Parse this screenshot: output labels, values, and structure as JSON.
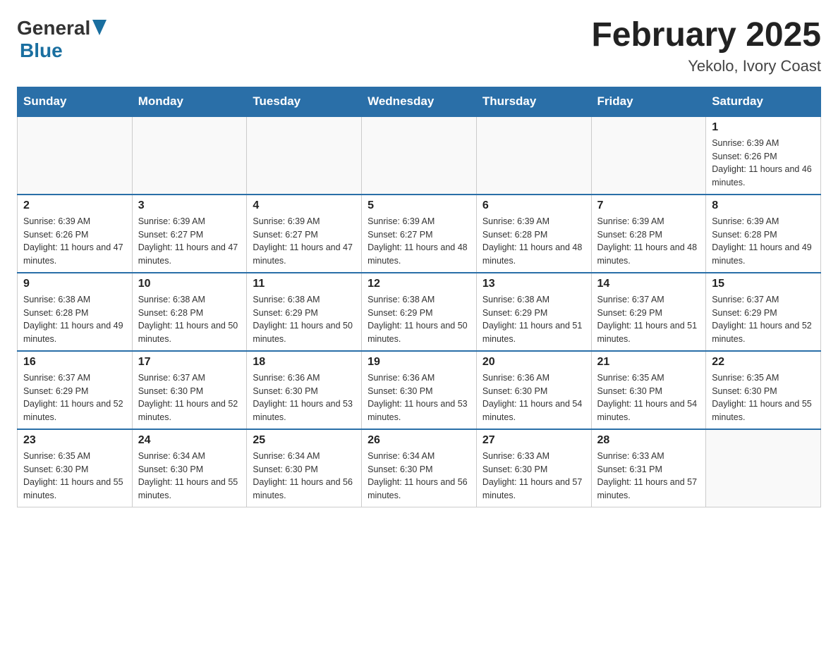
{
  "header": {
    "logo_general": "General",
    "logo_blue": "Blue",
    "month_title": "February 2025",
    "location": "Yekolo, Ivory Coast"
  },
  "days_of_week": [
    "Sunday",
    "Monday",
    "Tuesday",
    "Wednesday",
    "Thursday",
    "Friday",
    "Saturday"
  ],
  "weeks": [
    {
      "days": [
        {
          "date": "",
          "info": ""
        },
        {
          "date": "",
          "info": ""
        },
        {
          "date": "",
          "info": ""
        },
        {
          "date": "",
          "info": ""
        },
        {
          "date": "",
          "info": ""
        },
        {
          "date": "",
          "info": ""
        },
        {
          "date": "1",
          "info": "Sunrise: 6:39 AM\nSunset: 6:26 PM\nDaylight: 11 hours and 46 minutes."
        }
      ]
    },
    {
      "days": [
        {
          "date": "2",
          "info": "Sunrise: 6:39 AM\nSunset: 6:26 PM\nDaylight: 11 hours and 47 minutes."
        },
        {
          "date": "3",
          "info": "Sunrise: 6:39 AM\nSunset: 6:27 PM\nDaylight: 11 hours and 47 minutes."
        },
        {
          "date": "4",
          "info": "Sunrise: 6:39 AM\nSunset: 6:27 PM\nDaylight: 11 hours and 47 minutes."
        },
        {
          "date": "5",
          "info": "Sunrise: 6:39 AM\nSunset: 6:27 PM\nDaylight: 11 hours and 48 minutes."
        },
        {
          "date": "6",
          "info": "Sunrise: 6:39 AM\nSunset: 6:28 PM\nDaylight: 11 hours and 48 minutes."
        },
        {
          "date": "7",
          "info": "Sunrise: 6:39 AM\nSunset: 6:28 PM\nDaylight: 11 hours and 48 minutes."
        },
        {
          "date": "8",
          "info": "Sunrise: 6:39 AM\nSunset: 6:28 PM\nDaylight: 11 hours and 49 minutes."
        }
      ]
    },
    {
      "days": [
        {
          "date": "9",
          "info": "Sunrise: 6:38 AM\nSunset: 6:28 PM\nDaylight: 11 hours and 49 minutes."
        },
        {
          "date": "10",
          "info": "Sunrise: 6:38 AM\nSunset: 6:28 PM\nDaylight: 11 hours and 50 minutes."
        },
        {
          "date": "11",
          "info": "Sunrise: 6:38 AM\nSunset: 6:29 PM\nDaylight: 11 hours and 50 minutes."
        },
        {
          "date": "12",
          "info": "Sunrise: 6:38 AM\nSunset: 6:29 PM\nDaylight: 11 hours and 50 minutes."
        },
        {
          "date": "13",
          "info": "Sunrise: 6:38 AM\nSunset: 6:29 PM\nDaylight: 11 hours and 51 minutes."
        },
        {
          "date": "14",
          "info": "Sunrise: 6:37 AM\nSunset: 6:29 PM\nDaylight: 11 hours and 51 minutes."
        },
        {
          "date": "15",
          "info": "Sunrise: 6:37 AM\nSunset: 6:29 PM\nDaylight: 11 hours and 52 minutes."
        }
      ]
    },
    {
      "days": [
        {
          "date": "16",
          "info": "Sunrise: 6:37 AM\nSunset: 6:29 PM\nDaylight: 11 hours and 52 minutes."
        },
        {
          "date": "17",
          "info": "Sunrise: 6:37 AM\nSunset: 6:30 PM\nDaylight: 11 hours and 52 minutes."
        },
        {
          "date": "18",
          "info": "Sunrise: 6:36 AM\nSunset: 6:30 PM\nDaylight: 11 hours and 53 minutes."
        },
        {
          "date": "19",
          "info": "Sunrise: 6:36 AM\nSunset: 6:30 PM\nDaylight: 11 hours and 53 minutes."
        },
        {
          "date": "20",
          "info": "Sunrise: 6:36 AM\nSunset: 6:30 PM\nDaylight: 11 hours and 54 minutes."
        },
        {
          "date": "21",
          "info": "Sunrise: 6:35 AM\nSunset: 6:30 PM\nDaylight: 11 hours and 54 minutes."
        },
        {
          "date": "22",
          "info": "Sunrise: 6:35 AM\nSunset: 6:30 PM\nDaylight: 11 hours and 55 minutes."
        }
      ]
    },
    {
      "days": [
        {
          "date": "23",
          "info": "Sunrise: 6:35 AM\nSunset: 6:30 PM\nDaylight: 11 hours and 55 minutes."
        },
        {
          "date": "24",
          "info": "Sunrise: 6:34 AM\nSunset: 6:30 PM\nDaylight: 11 hours and 55 minutes."
        },
        {
          "date": "25",
          "info": "Sunrise: 6:34 AM\nSunset: 6:30 PM\nDaylight: 11 hours and 56 minutes."
        },
        {
          "date": "26",
          "info": "Sunrise: 6:34 AM\nSunset: 6:30 PM\nDaylight: 11 hours and 56 minutes."
        },
        {
          "date": "27",
          "info": "Sunrise: 6:33 AM\nSunset: 6:30 PM\nDaylight: 11 hours and 57 minutes."
        },
        {
          "date": "28",
          "info": "Sunrise: 6:33 AM\nSunset: 6:31 PM\nDaylight: 11 hours and 57 minutes."
        },
        {
          "date": "",
          "info": ""
        }
      ]
    }
  ]
}
